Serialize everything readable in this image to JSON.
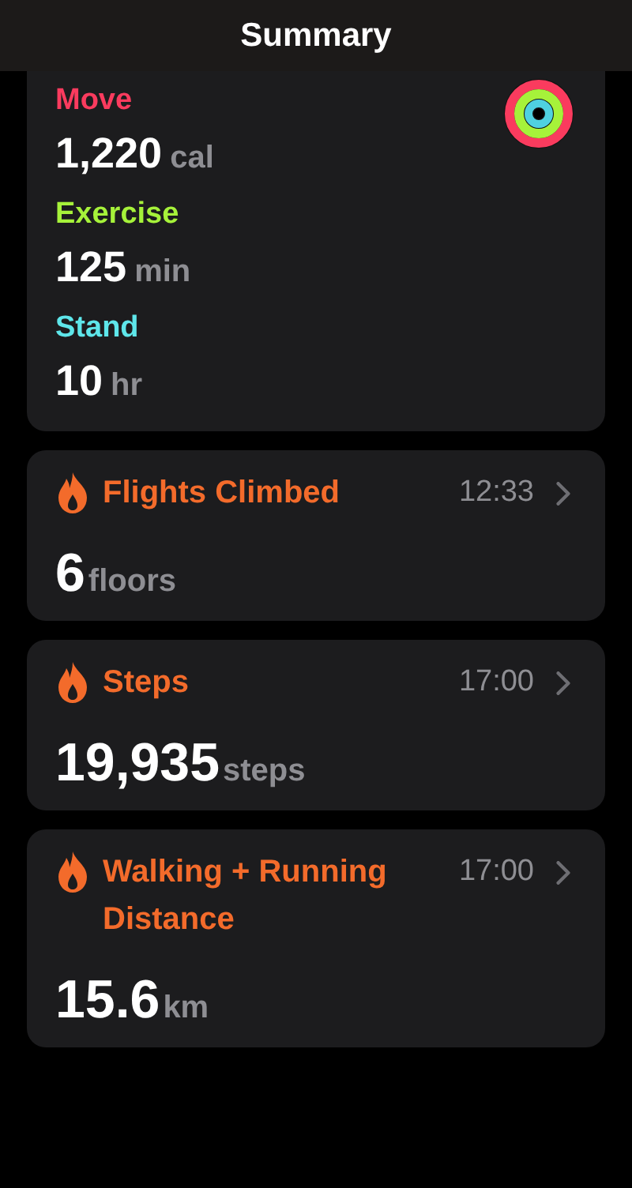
{
  "header": {
    "title": "Summary"
  },
  "activity": [
    {
      "label": "Move",
      "value": "1,220",
      "unit": "cal",
      "color": "#fa3b5e"
    },
    {
      "label": "Exercise",
      "value": "125",
      "unit": "min",
      "color": "#a6f23a"
    },
    {
      "label": "Stand",
      "value": "10",
      "unit": "hr",
      "color": "#5ee6ea"
    }
  ],
  "metrics": [
    {
      "title": "Flights Climbed",
      "time": "12:33",
      "value": "6",
      "unit": "floors"
    },
    {
      "title": "Steps",
      "time": "17:00",
      "value": "19,935",
      "unit": "steps"
    },
    {
      "title": "Walking + Running Distance",
      "time": "17:00",
      "value": "15.6",
      "unit": "km"
    }
  ]
}
